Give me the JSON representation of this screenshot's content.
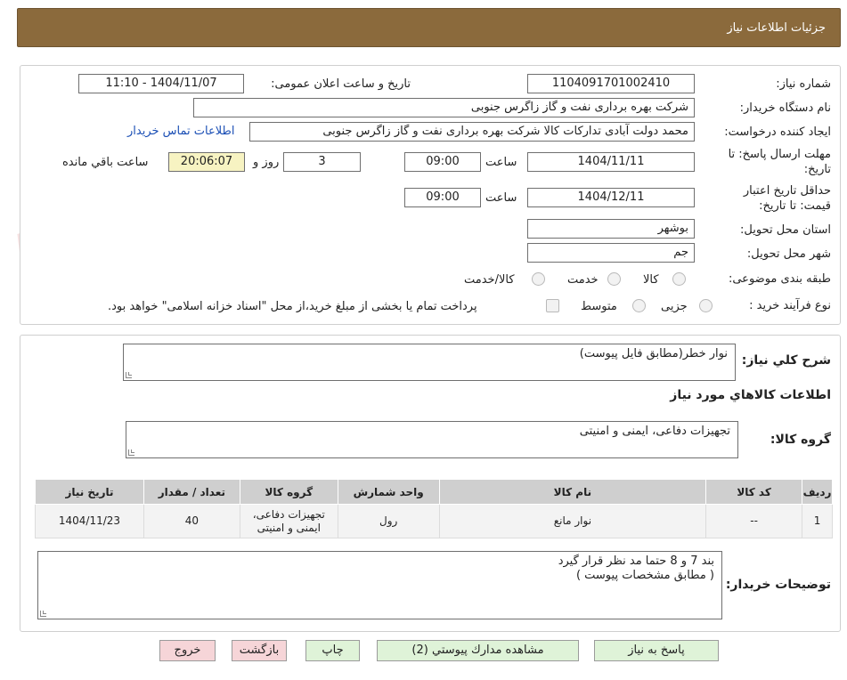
{
  "header": {
    "title": "جزئیات اطلاعات نیاز"
  },
  "form": {
    "need_number_label": "شماره نیاز:",
    "need_number": "1104091701002410",
    "announce_label": "تاریخ و ساعت اعلان عمومی:",
    "announce_value": "1404/11/07 - 11:10",
    "buyer_org_label": "نام دستگاه خریدار:",
    "buyer_org": "شرکت بهره برداری نفت و گاز زاگرس جنوبی",
    "creator_label": "ایجاد کننده درخواست:",
    "creator": "محمد دولت آبادی تداركات كالا شرکت بهره برداری نفت و گاز زاگرس جنوبی",
    "contact_link": "اطلاعات تماس خریدار",
    "deadline_label_1": "مهلت ارسال پاسخ: تا",
    "deadline_label_2": "تاریخ:",
    "deadline_date": "1404/11/11",
    "time_label": "ساعت",
    "deadline_time": "09:00",
    "days_value": "3",
    "days_label": "روز و",
    "remaining_time": "20:06:07",
    "remaining_label": "ساعت باقي مانده",
    "validity_label_1": "حداقل تاریخ اعتبار",
    "validity_label_2": "قیمت: تا تاریخ:",
    "validity_date": "1404/12/11",
    "validity_time": "09:00",
    "province_label": "استان محل تحویل:",
    "province": "بوشهر",
    "city_label": "شهر محل تحویل:",
    "city": "جم",
    "category_label": "طبقه بندی موضوعی:",
    "category_options": [
      "کالا",
      "خدمت",
      "کالا/خدمت"
    ],
    "process_label": "نوع فرآیند خرید :",
    "process_options": [
      "جزیی",
      "متوسط"
    ],
    "payment_note": "پرداخت تمام یا بخشی از مبلغ خرید،از محل \"اسناد خزانه اسلامی\" خواهد بود."
  },
  "details": {
    "summary_label": "شرح كلي نیاز:",
    "summary": "نوار خطر(مطابق فایل پیوست)",
    "goods_title": "اطلاعات كالاهاي مورد نیاز",
    "group_label": "گروه كالا:",
    "group_value": "تجهیزات دفاعی، ایمنی و امنیتی",
    "table": {
      "headers": [
        "ردیف",
        "کد کالا",
        "نام کالا",
        "واحد شمارش",
        "گروه کالا",
        "تعداد / مقدار",
        "تاریخ نیاز"
      ],
      "rows": [
        [
          "1",
          "--",
          "نوار مانع",
          "رول",
          "تجهیزات دفاعی، ایمنی و امنیتی",
          "40",
          "1404/11/23"
        ]
      ]
    },
    "buyer_notes_label": "توضیحات خریدار:",
    "buyer_notes_line1": "بند  7   و 8  حتما مد نظر قرار گیرد",
    "buyer_notes_line2": "( مطابق مشخصات پیوست )"
  },
  "buttons": {
    "reply": "پاسخ به نیاز",
    "attachments": "مشاهده مدارك پیوستي (2)",
    "print": "چاپ",
    "back": "بازگشت",
    "exit": "خروج"
  },
  "watermark": {
    "text": "AriaTender.neT"
  },
  "colors": {
    "header": "#8b6a3c",
    "link": "#1b4fb5",
    "timer_bg": "#f7f3c2",
    "btn_green": "#dff3d8",
    "btn_pink": "#f6d5d8"
  }
}
